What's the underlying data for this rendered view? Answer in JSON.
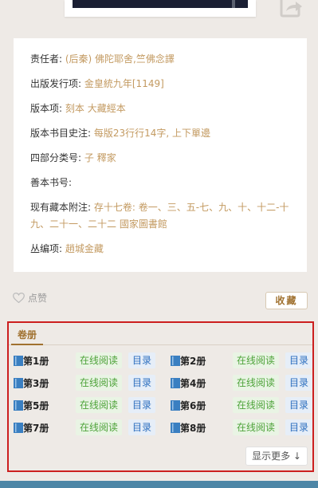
{
  "info": {
    "rows": [
      {
        "label": "责任者:",
        "value": "(后秦) 佛陀耶舍,竺佛念譯"
      },
      {
        "label": "出版发行项:",
        "value": "金皇統九年[1149]"
      },
      {
        "label": "版本项:",
        "value": "刻本 大藏經本"
      },
      {
        "label": "版本书目史注:",
        "value": "每版23行行14字, 上下單邊"
      },
      {
        "label": "四部分类号:",
        "value": "子 釋家"
      },
      {
        "label": "善本书号:",
        "value": ""
      },
      {
        "label": "现有藏本附注:",
        "value": "存十七卷: 卷一、三、五-七、九、十、十二-十九、二十一、二十二 國家圖書館"
      },
      {
        "label": "丛编项:",
        "value": "趙城金藏"
      }
    ]
  },
  "actions": {
    "like_label": "点赞",
    "collect_label": "收藏"
  },
  "volumes": {
    "tab_label": "卷册",
    "read_label": "在线阅读",
    "toc_label": "目录",
    "items": [
      {
        "name": "第1册"
      },
      {
        "name": "第2册"
      },
      {
        "name": "第3册"
      },
      {
        "name": "第4册"
      },
      {
        "name": "第5册"
      },
      {
        "name": "第6册"
      },
      {
        "name": "第7册"
      },
      {
        "name": "第8册"
      }
    ],
    "more_label": "显示更多 ↓"
  }
}
